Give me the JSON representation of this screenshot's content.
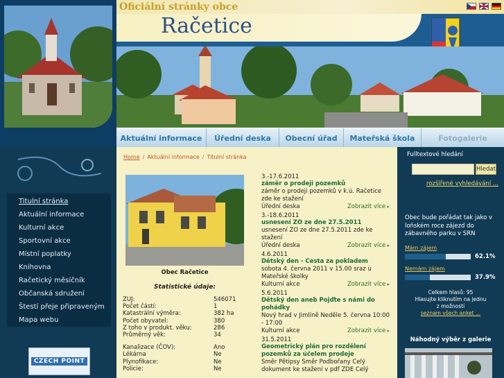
{
  "header": {
    "official": "Oficiální stránky obce",
    "site_title": "Račetice",
    "flags": [
      "flag-cz",
      "flag-en",
      "flag-de"
    ]
  },
  "topnav": [
    "Aktuální informace",
    "Úřední deska",
    "Obecní úřad",
    "Mateřská škola",
    "Fotogalerie"
  ],
  "leftmenu": [
    "Titulní stránka",
    "Aktuální informace",
    "Kulturní akce",
    "Sportovní akce",
    "Místní poplatky",
    "Knihovna",
    "Račetický měsíčník",
    "Občanská sdružení",
    "Štestí přeje připraveným",
    "Mapa webu"
  ],
  "czechpoint": "CZECH POINT",
  "breadcrumb": {
    "home": "Home",
    "section": "Aktuální informace",
    "current": "Titulní stránka"
  },
  "village": {
    "caption": "Obec Račetice",
    "stats_title": "Statistické údaje:"
  },
  "stats": [
    {
      "k": "ZUJ:",
      "v": "546071"
    },
    {
      "k": "Počet částí:",
      "v": "1"
    },
    {
      "k": "Katastrální výměra:",
      "v": "382 ha"
    },
    {
      "k": "Počet obyvatel:",
      "v": "380"
    },
    {
      "k": "Z toho v produkt. věku:",
      "v": "286"
    },
    {
      "k": "Průměrný věk:",
      "v": "34"
    }
  ],
  "stats2": [
    {
      "k": "Kanalizace (ČOV):",
      "v": "Ano"
    },
    {
      "k": "Lékárna",
      "v": "Ne"
    },
    {
      "k": "Plynofikace:",
      "v": "Ne"
    },
    {
      "k": "Policie:",
      "v": "Ne"
    }
  ],
  "news": [
    {
      "date": "3.-17.6.2011",
      "title": "záměr o prodeji pozemků",
      "body": "záměr o prodeji pozemků v k.ú. Račetice zde ke stažení",
      "cat": "Úřední deska",
      "more": "Zobrazit více"
    },
    {
      "date": "3.-18.6.2011",
      "title": "usnesení ZO ze dne 27.5.2011",
      "body": "usnesení ZO ze dne 27.5.2011 zde ke stažení",
      "cat": "Úřední deska",
      "more": "Zobrazit více"
    },
    {
      "date": "4.6.2011",
      "title": "Dětský den - Cesta za pokladem",
      "body": "sobota 4. června 2011 v 15.00 sraz u Mateřské školky",
      "cat": "Kulturní akce",
      "more": "Zobrazit více"
    },
    {
      "date": "5.6.2011",
      "title": "Dětský den aneb Pojďte s námi do pohádky",
      "body": "Nový hrad v Jimlíně Neděle 5. června 10:00 - 17:00",
      "cat": "Kulturní akce",
      "more": "Zobrazit více"
    },
    {
      "date": "31.5.2011",
      "title": "Geometrický plán pro rozdělení pozemků za účelem prodeje",
      "body": "Směr Pětipsy Směr Podbořany Celý dokument ke stažení v pdf ZDE Celý",
      "cat": "",
      "more": ""
    }
  ],
  "search": {
    "label": "Fulltextové hledání",
    "placeholder": "",
    "button": "Hledat",
    "advanced": "rozšířené vyhledávání ..."
  },
  "poll": {
    "question": "Obec bude pořádat tak jako v loňském roce zájezd do zábavného parku v SRN",
    "options": [
      {
        "label": "Mám zájem",
        "pct": "62.1%",
        "value": 0.621
      },
      {
        "label": "Nemám zájem",
        "pct": "37.9%",
        "value": 0.379
      }
    ],
    "total": "Celkem hlasů: 95",
    "hint1": "Hlasujte kliknutím na jednu",
    "hint2": "z možností",
    "all": "seznam všech anket ..."
  },
  "gallery": {
    "title": "Náhodný výběr z galerie"
  },
  "colors": {
    "accent": "#1e5d92",
    "sidebar": "#113a54",
    "content": "#f6f1c6",
    "news_title": "#1e6a3a",
    "link": "#c45522"
  }
}
